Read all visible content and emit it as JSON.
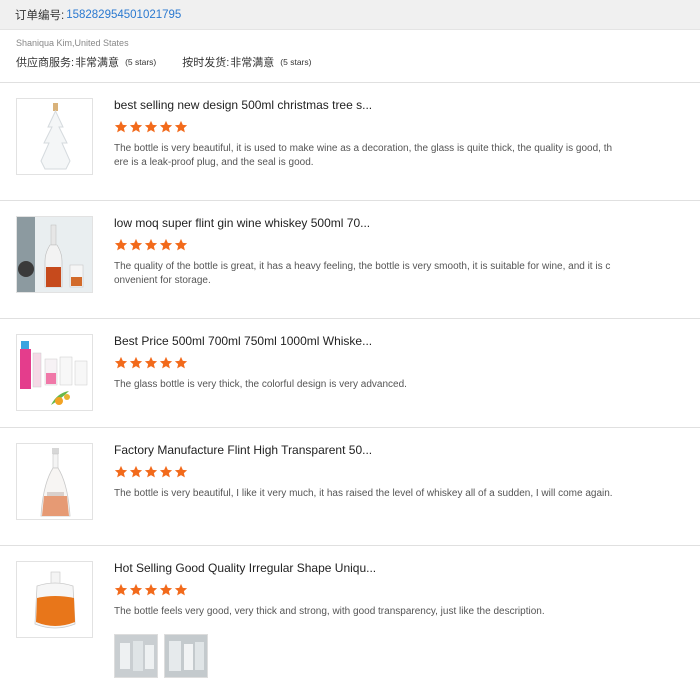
{
  "order": {
    "label": "订单编号:",
    "number": "158282954501021795"
  },
  "buyer": {
    "name": "Shaniqua Kim,United States",
    "ratings": [
      {
        "label": "供应商服务:",
        "value": "非常满意",
        "stars": "(5 stars)"
      },
      {
        "label": "按时发货:",
        "value": "非常满意",
        "stars": "(5 stars)"
      }
    ]
  },
  "star_color": "#f26a1b",
  "reviews": [
    {
      "title": "best selling new design 500ml christmas tree s...",
      "rating": 5,
      "text": "The bottle is very beautiful, it is used to make wine as a decoration, the glass is quite thick, the quality is good, there is a leak-proof plug, and the seal is good."
    },
    {
      "title": "low moq super flint gin wine whiskey 500ml 70...",
      "rating": 5,
      "text": "The quality of the bottle is great, it has a heavy feeling, the bottle is very smooth, it is suitable for wine, and it is convenient for storage."
    },
    {
      "title": "Best Price 500ml 700ml 750ml 1000ml Whiske...",
      "rating": 5,
      "text": "The glass bottle is very thick, the colorful design is very advanced."
    },
    {
      "title": "Factory Manufacture Flint High Transparent 50...",
      "rating": 5,
      "text": "The bottle is very beautiful, I like it very much, it has raised the level of whiskey all of a sudden, I will come again."
    },
    {
      "title": "Hot Selling Good Quality Irregular Shape Uniqu...",
      "rating": 5,
      "text": "The bottle feels very good, very thick and strong, with good transparency, just like the description."
    }
  ]
}
